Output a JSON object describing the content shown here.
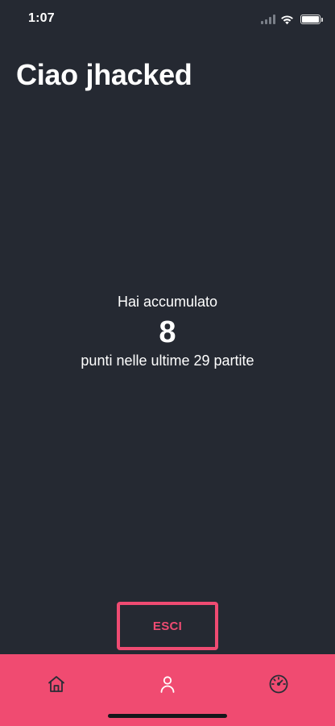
{
  "status_bar": {
    "time": "1:07",
    "icons": [
      "signal-icon",
      "wifi-icon",
      "battery-icon"
    ]
  },
  "greeting": {
    "text": "Ciao jhacked"
  },
  "summary": {
    "prefix": "Hai accumulato",
    "points": "8",
    "suffix": "punti nelle ultime 29 partite"
  },
  "actions": {
    "exit_label": "ESCI"
  },
  "tab_bar": {
    "items": [
      {
        "icon": "home-icon",
        "active": false
      },
      {
        "icon": "user-icon",
        "active": true
      },
      {
        "icon": "speedometer-icon",
        "active": false
      }
    ]
  },
  "colors": {
    "background": "#252932",
    "accent": "#f04b71",
    "text": "#ffffff"
  }
}
